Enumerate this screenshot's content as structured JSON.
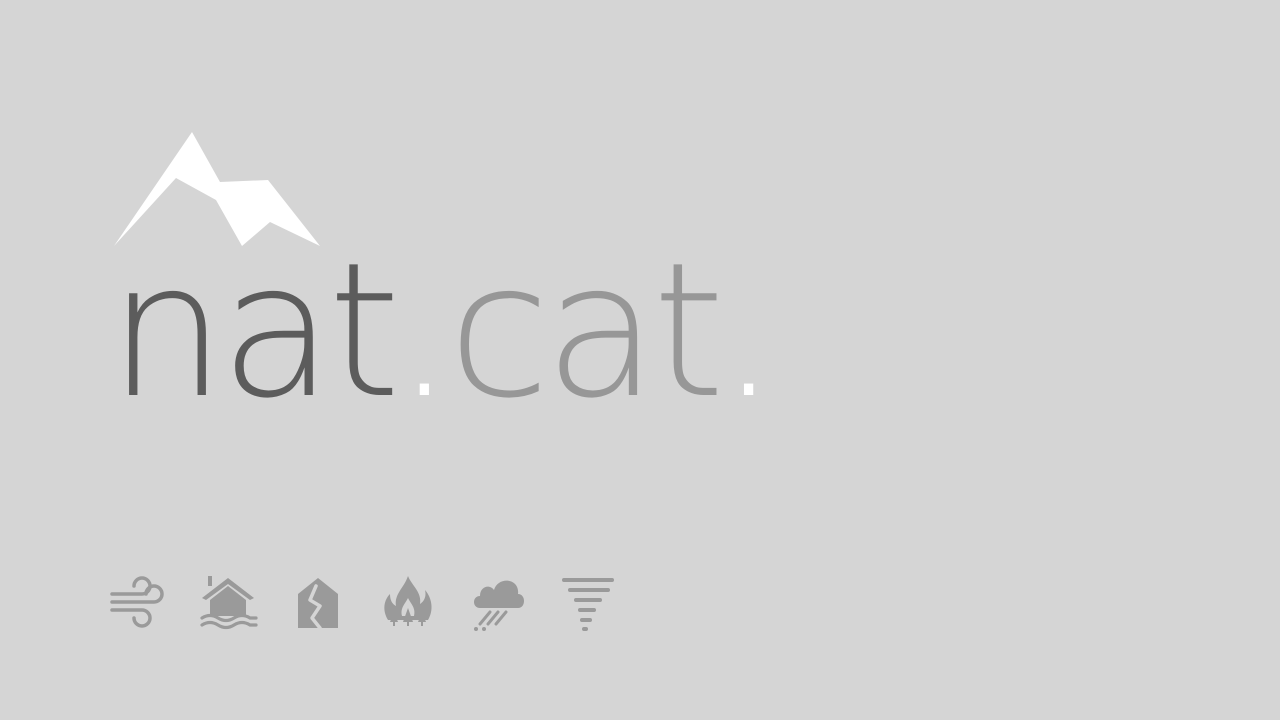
{
  "brand": {
    "word_1": "nat",
    "dot_1": ".",
    "word_2": "cat",
    "dot_2": "."
  },
  "colors": {
    "background": "#d5d5d5",
    "word_dark": "#5c5c5c",
    "word_light": "#979797",
    "accent_white": "#ffffff",
    "icon_grey": "#9a9a9a"
  },
  "icons": {
    "logo": "mountain-icon",
    "hazards": [
      "wind-icon",
      "flood-icon",
      "earthquake-icon",
      "wildfire-icon",
      "hail-icon",
      "tornado-icon"
    ]
  }
}
